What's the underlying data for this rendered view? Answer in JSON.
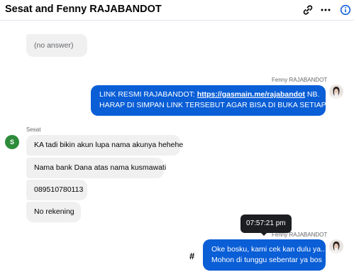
{
  "header": {
    "title": "Sesat and Fenny RAJABANDOT",
    "link_icon": "link-icon",
    "more_icon": "more-options-icon",
    "info_icon": "info-icon",
    "accent_color": "#0a5ed6"
  },
  "messages": {
    "prev": {
      "text": "(no answer)"
    },
    "fenny1": {
      "sender": "Fenny RAJABANDOT",
      "line1_prefix": "LINK RESMI RAJABANDOT: ",
      "link": "https://gasmain.me/rajabandot",
      "line1_suffix": " NB.",
      "line2": "HARAP DI SIMPAN LINK TERSEBUT AGAR BISA DI BUKA SETIAP SAAT."
    },
    "sesat": {
      "sender": "Sesat",
      "avatar_initial": "S",
      "items": [
        "KA tadi bikin akun lupa nama akunya hehehe",
        "Nama bank Dana atas nama kusmawati",
        "089510780113",
        "No rekening"
      ]
    },
    "fenny2": {
      "sender": "Fenny RAJABANDOT",
      "line1": "Oke bosku, kami cek kan dulu ya..",
      "line2": "Mohon di tunggu sebentar ya bos",
      "timestamp_tooltip": "07:57:21 pm",
      "hash": "#"
    }
  }
}
